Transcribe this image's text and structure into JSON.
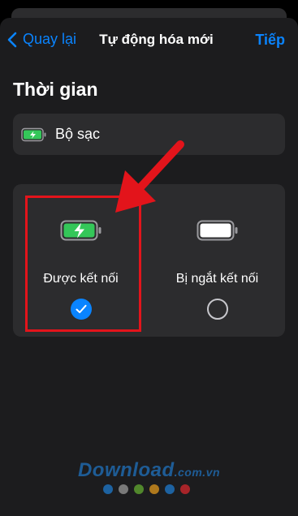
{
  "nav": {
    "back_label": "Quay lại",
    "title": "Tự động hóa mới",
    "next_label": "Tiếp"
  },
  "section": {
    "title": "Thời gian"
  },
  "trigger": {
    "icon": "battery-charging-icon",
    "label": "Bộ sạc"
  },
  "options": [
    {
      "label": "Được kết nối",
      "icon": "battery-charging-icon",
      "selected": true
    },
    {
      "label": "Bị ngắt kết nối",
      "icon": "battery-full-icon",
      "selected": false
    }
  ],
  "watermark": {
    "brand": "Download",
    "suffix": ".com.vn",
    "dot_colors": [
      "#1d6fb8",
      "#8a8a8a",
      "#5a9a2f",
      "#c98a1d",
      "#1d6fb8",
      "#c0262b"
    ]
  },
  "colors": {
    "accent": "#0a84ff",
    "highlight": "#e3141b",
    "battery_green": "#34c759"
  }
}
